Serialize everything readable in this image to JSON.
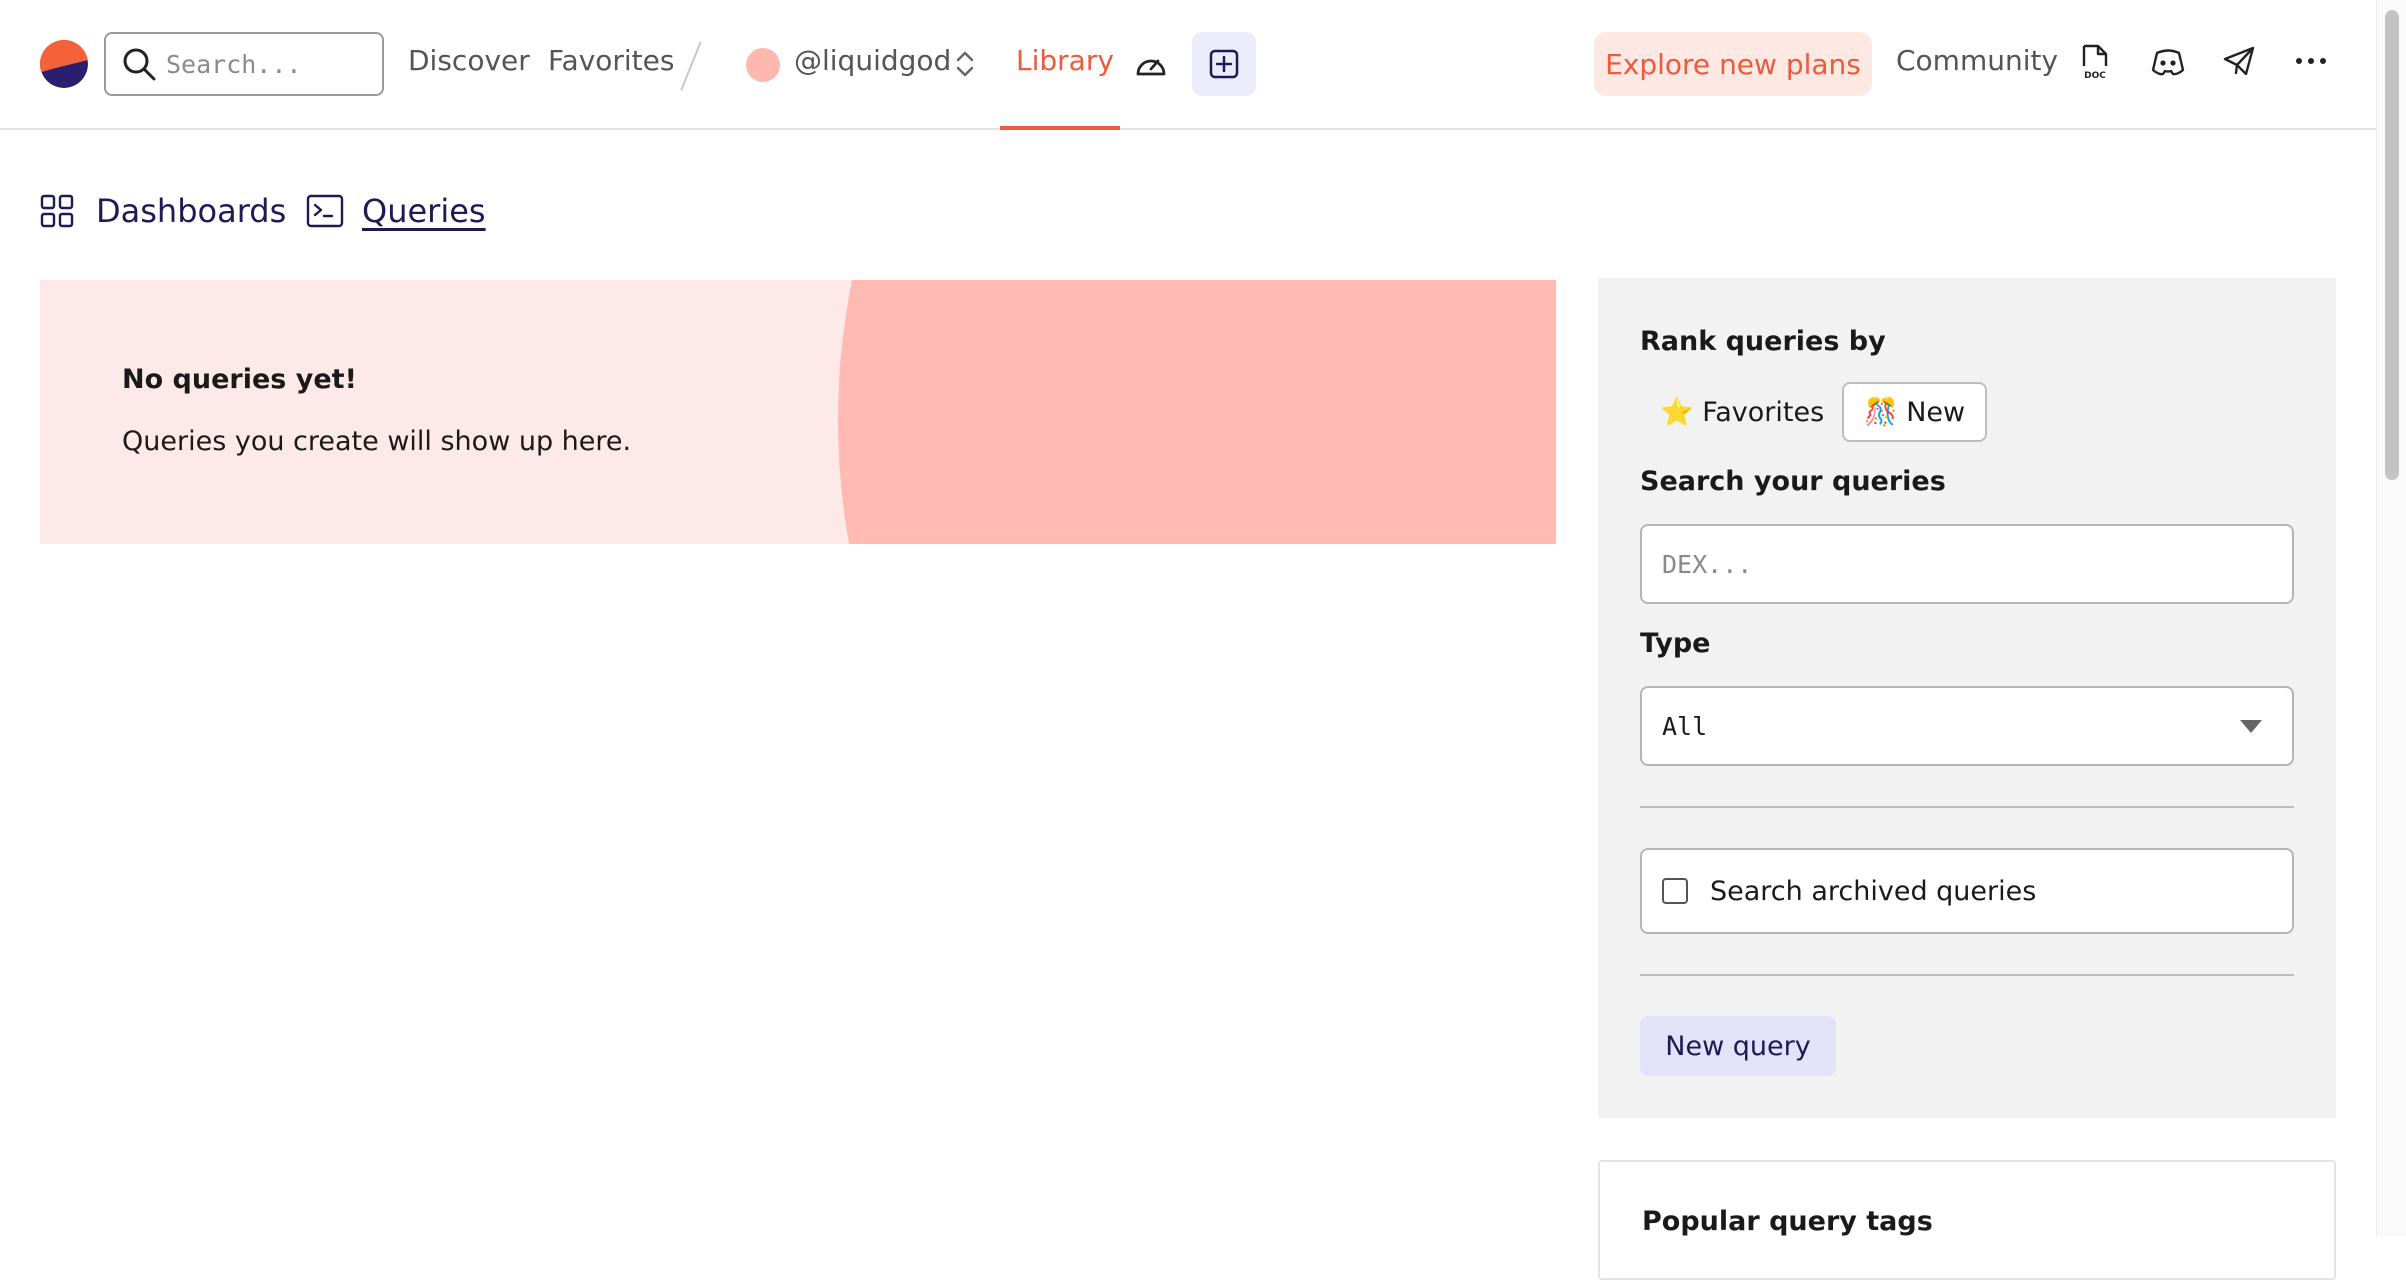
{
  "nav": {
    "search_placeholder": "Search...",
    "discover": "Discover",
    "favorites": "Favorites",
    "team": "@liquidgod",
    "library": "Library",
    "explore": "Explore new plans",
    "community": "Community",
    "doc_icon_label": "DOC"
  },
  "tabs": {
    "dashboards": "Dashboards",
    "queries": "Queries"
  },
  "empty_state": {
    "title": "No queries yet!",
    "subtitle": "Queries you create will show up here."
  },
  "sidebar": {
    "rank_label": "Rank queries by",
    "rank_favorites": "⭐ Favorites",
    "rank_new": "🎊 New",
    "search_label": "Search your queries",
    "search_placeholder": "DEX...",
    "type_label": "Type",
    "type_value": "All",
    "archived_label": "Search archived queries",
    "new_query": "New query",
    "popular_tags": "Popular query tags"
  },
  "colors": {
    "accent": "#ec5b3a",
    "navy": "#1d1a55",
    "empty_bg": "#fde9e8",
    "empty_circle": "#ffbbb3"
  }
}
